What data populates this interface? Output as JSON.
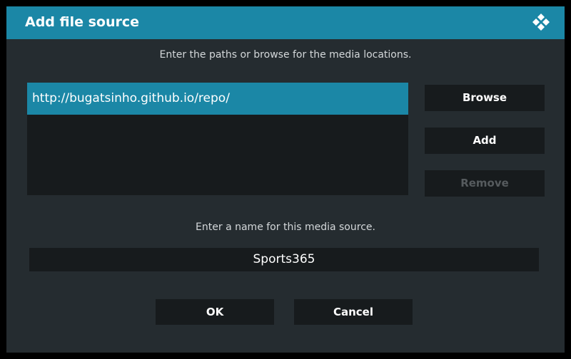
{
  "dialog": {
    "title": "Add file source",
    "logo_icon": "kodi-logo-icon",
    "accent_color": "#1b87a6"
  },
  "paths": {
    "instruction": "Enter the paths or browse for the media locations.",
    "items": [
      "http://bugatsinho.github.io/repo/"
    ]
  },
  "buttons": {
    "browse": "Browse",
    "add": "Add",
    "remove": "Remove",
    "ok": "OK",
    "cancel": "Cancel"
  },
  "source_name": {
    "instruction": "Enter a name for this media source.",
    "value": "Sports365"
  }
}
